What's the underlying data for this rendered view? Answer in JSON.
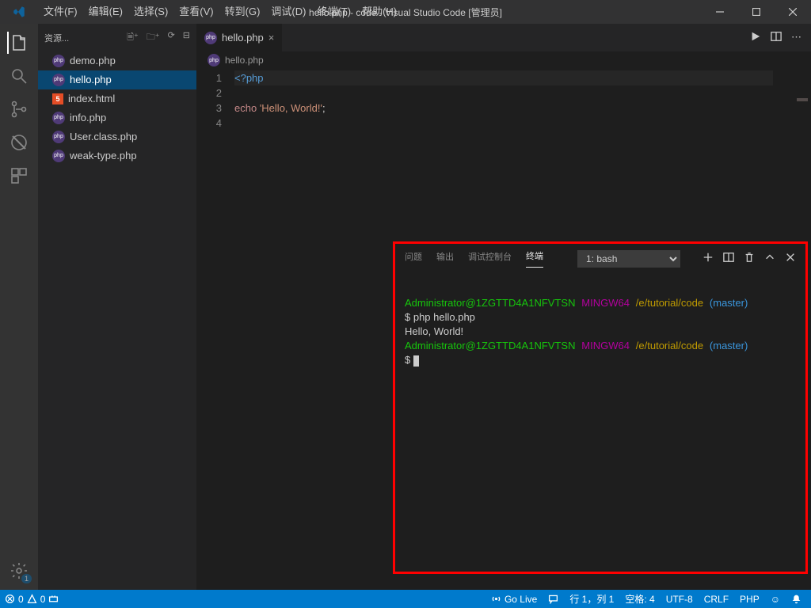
{
  "title": "hello.php - code - Visual Studio Code [管理员]",
  "menu": {
    "items": [
      "文件(F)",
      "编辑(E)",
      "选择(S)",
      "查看(V)",
      "转到(G)",
      "调试(D)",
      "终端(T)",
      "帮助(H)"
    ]
  },
  "sidebar": {
    "header": "资源...",
    "files": [
      {
        "name": "demo.php",
        "icon": "php"
      },
      {
        "name": "hello.php",
        "icon": "php",
        "active": true
      },
      {
        "name": "index.html",
        "icon": "html"
      },
      {
        "name": "info.php",
        "icon": "php"
      },
      {
        "name": "User.class.php",
        "icon": "php"
      },
      {
        "name": "weak-type.php",
        "icon": "php"
      }
    ]
  },
  "tab": {
    "name": "hello.php"
  },
  "breadcrumb": {
    "file": "hello.php"
  },
  "code": {
    "line1": "<?php",
    "line2": "",
    "line3_a": "echo ",
    "line3_b": "'Hello, World!'",
    "line3_c": ";",
    "line4": ""
  },
  "panel": {
    "tabs": [
      "问题",
      "输出",
      "调试控制台",
      "终端"
    ],
    "active": "终端",
    "select": "1: bash"
  },
  "terminal": {
    "user1": "Administrator@1ZGTTD4A1NFVTSN",
    "env": "MINGW64",
    "path": "/e/tutorial/code",
    "branch": "(master)",
    "cmd": "$ php hello.php",
    "out": "Hello, World!",
    "prompt2": "$ "
  },
  "status": {
    "errors": "0",
    "warnings": "0",
    "golive": "Go Live",
    "lncol": "行 1，列 1",
    "spaces": "空格: 4",
    "encoding": "UTF-8",
    "eol": "CRLF",
    "lang": "PHP",
    "smile": "☺"
  },
  "gear_badge": "1"
}
